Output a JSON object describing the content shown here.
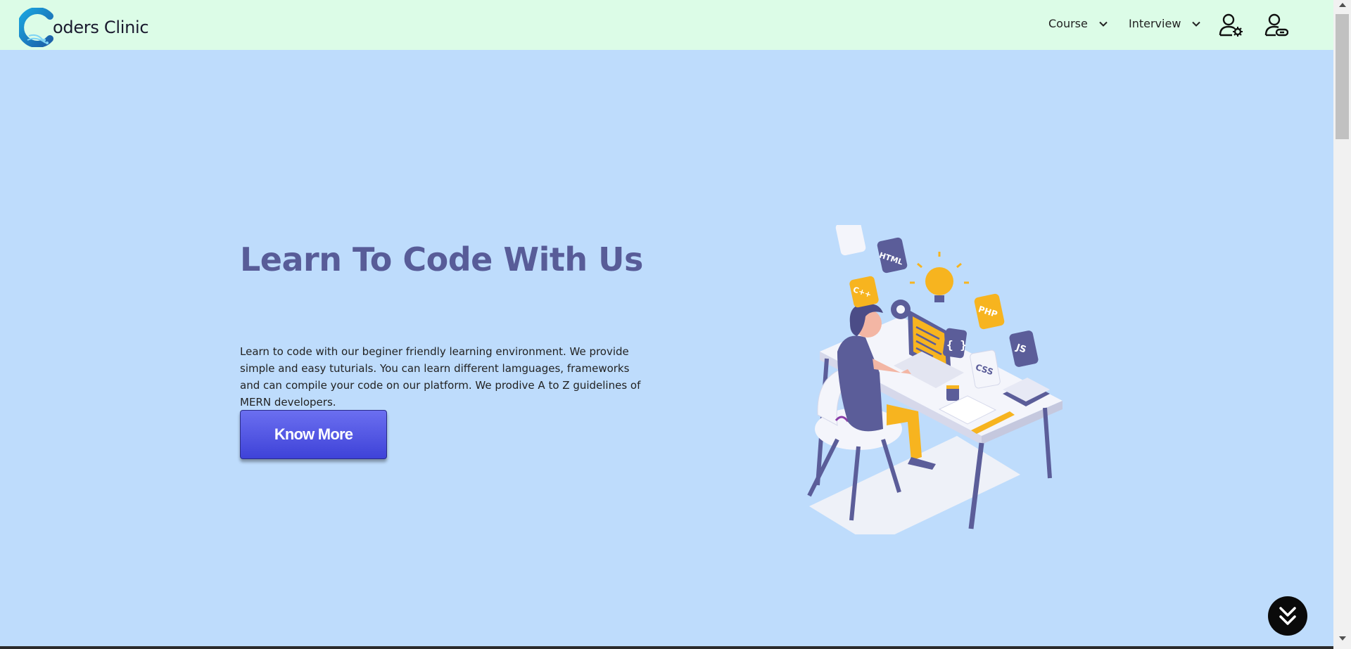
{
  "navbar": {
    "brand": {
      "logo_letter": "C",
      "text": "oders Clinic"
    },
    "menu": [
      {
        "label": "Course",
        "icon": "chevron-down-icon"
      },
      {
        "label": "Interview",
        "icon": "chevron-down-icon"
      }
    ],
    "icons": [
      "user-settings-icon",
      "user-link-icon"
    ]
  },
  "hero": {
    "title": "Learn To Code With Us",
    "description": "Learn to code with our beginer friendly learning environment. We provide simple and easy tuturials. You can learn different lamguages, frameworks and can compile your code on our platform. We prodive A to Z guidelines of MERN developers.",
    "cta_label": "Know More"
  },
  "illustration": {
    "tags": [
      "HTML",
      "C++",
      "PHP",
      "JS",
      "CSS",
      "{ }"
    ]
  },
  "floating": {
    "icon": "double-chevron-down-icon"
  },
  "colors": {
    "navbar_bg": "#dcfce7",
    "page_bg": "#bedcfc",
    "title": "#585c98",
    "button_top": "#6b6ff0",
    "button_bottom": "#3e42d8"
  }
}
